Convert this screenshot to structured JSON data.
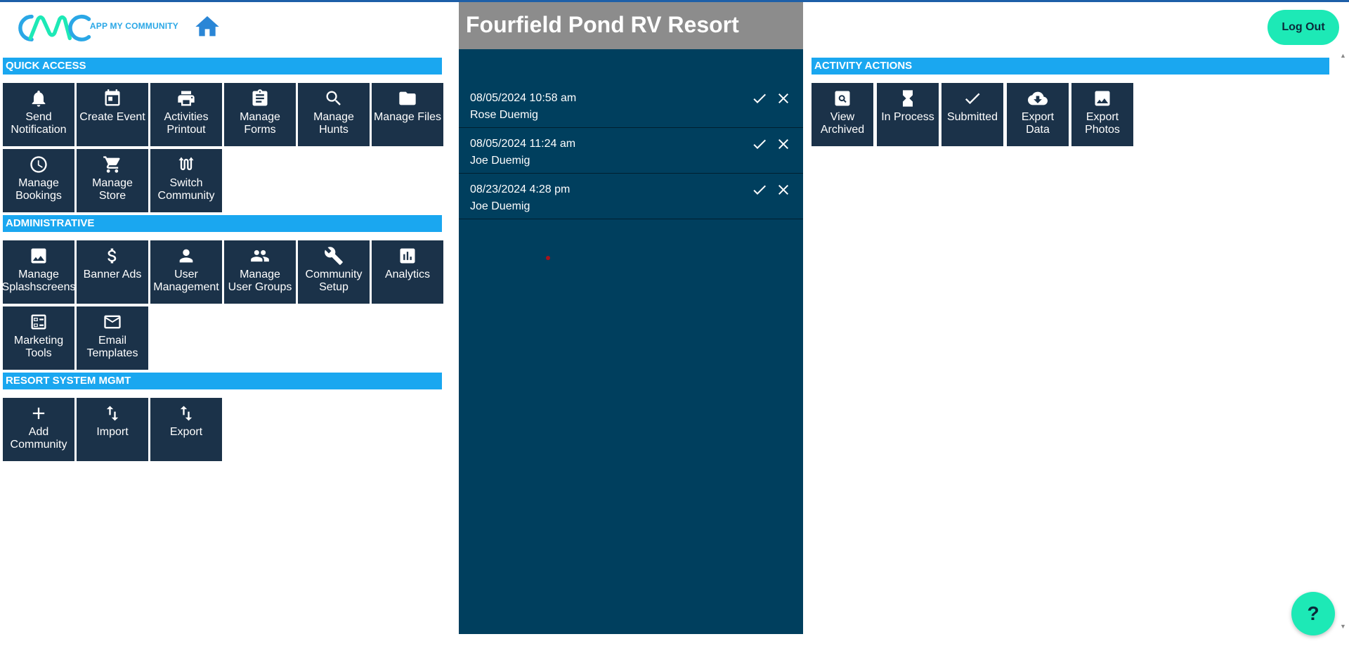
{
  "header": {
    "logo_text": "APP MY COMMUNITY",
    "logout_label": "Log Out",
    "accent": "#1de9b6",
    "brand": "#2aa7e6"
  },
  "sections": {
    "quick_access": {
      "title": "QUICK ACCESS",
      "tiles": [
        {
          "label": "Send\nNotification",
          "icon": "bell-icon"
        },
        {
          "label": "Create Event",
          "icon": "calendar-icon"
        },
        {
          "label": "Activities\nPrintout",
          "icon": "printer-icon"
        },
        {
          "label": "Manage\nForms",
          "icon": "clipboard-icon"
        },
        {
          "label": "Manage\nHunts",
          "icon": "search-icon"
        },
        {
          "label": "Manage Files",
          "icon": "folder-icon"
        },
        {
          "label": "Manage\nBookings",
          "icon": "clock-icon"
        },
        {
          "label": "Manage\nStore",
          "icon": "cart-icon"
        },
        {
          "label": "Switch\nCommunity",
          "icon": "switch-icon"
        }
      ]
    },
    "administrative": {
      "title": "ADMINISTRATIVE",
      "tiles": [
        {
          "label": "Manage\nSplashscreens",
          "icon": "image-icon"
        },
        {
          "label": "Banner Ads",
          "icon": "dollar-icon"
        },
        {
          "label": "User\nManagement",
          "icon": "person-icon"
        },
        {
          "label": "Manage\nUser Groups",
          "icon": "people-icon"
        },
        {
          "label": "Community\nSetup",
          "icon": "wrench-icon"
        },
        {
          "label": "Analytics",
          "icon": "bar-chart-icon"
        },
        {
          "label": "Marketing\nTools",
          "icon": "checklist-icon"
        },
        {
          "label": "Email\nTemplates",
          "icon": "envelope-icon"
        }
      ]
    },
    "resort_system": {
      "title": "RESORT SYSTEM MGMT",
      "tiles": [
        {
          "label": "Add\nCommunity",
          "icon": "plus-icon"
        },
        {
          "label": "Import",
          "icon": "import-arrows-icon"
        },
        {
          "label": "Export",
          "icon": "export-arrows-icon"
        }
      ]
    },
    "activity_actions": {
      "title": "ACTIVITY ACTIONS",
      "tiles": [
        {
          "label": "View\nArchived",
          "icon": "view-archived-icon"
        },
        {
          "label": "In Process",
          "icon": "hourglass-icon"
        },
        {
          "label": "Submitted",
          "icon": "check-icon"
        },
        {
          "label": "Export\nData",
          "icon": "cloud-download-icon"
        },
        {
          "label": "Export\nPhotos",
          "icon": "image-icon"
        }
      ]
    }
  },
  "center": {
    "title": "Fourfield Pond RV Resort",
    "entries": [
      {
        "datetime": "08/05/2024 10:58 am",
        "name": "Rose Duemig"
      },
      {
        "datetime": "08/05/2024 11:24 am",
        "name": "Joe Duemig"
      },
      {
        "datetime": "08/23/2024 4:28 pm",
        "name": "Joe Duemig"
      }
    ]
  },
  "help": {
    "label": "?"
  },
  "scrollbar": {
    "up": "▲",
    "down": "▼"
  }
}
